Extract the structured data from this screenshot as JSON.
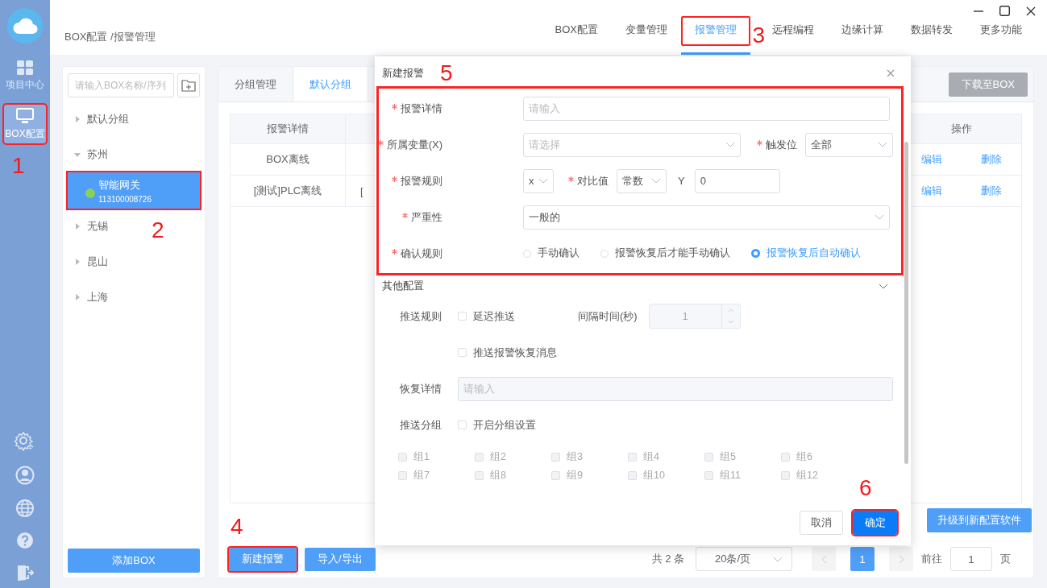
{
  "sidebar": {
    "nav": [
      {
        "label": "项目中心",
        "selected": false,
        "highlighted": false
      },
      {
        "label": "BOX配置",
        "selected": true,
        "highlighted": true,
        "annotation": "1"
      }
    ]
  },
  "breadcrumb": "BOX配置 /报警管理",
  "top_tabs": [
    {
      "label": "BOX配置",
      "selected": false,
      "highlighted": false
    },
    {
      "label": "变量管理",
      "selected": false,
      "highlighted": false
    },
    {
      "label": "报警管理",
      "selected": true,
      "highlighted": true,
      "annotation": "3"
    },
    {
      "label": "远程编程",
      "selected": false,
      "highlighted": false
    },
    {
      "label": "边缘计算",
      "selected": false,
      "highlighted": false
    },
    {
      "label": "数据转发",
      "selected": false,
      "highlighted": false
    },
    {
      "label": "更多功能",
      "selected": false,
      "highlighted": false
    }
  ],
  "box_panel": {
    "search_placeholder": "请输入BOX名称/序列",
    "tree": [
      {
        "label": "默认分组",
        "expanded": false
      },
      {
        "label": "苏州",
        "expanded": true,
        "children": [
          {
            "label": "智能网关",
            "serial": "113100008726",
            "selected": true,
            "online": true,
            "highlighted": true,
            "annotation": "2"
          }
        ]
      },
      {
        "label": "无锡",
        "expanded": false
      },
      {
        "label": "昆山",
        "expanded": false
      },
      {
        "label": "上海",
        "expanded": false
      }
    ],
    "add_button": "添加BOX"
  },
  "group_tabs": [
    {
      "label": "分组管理",
      "selected": false
    },
    {
      "label": "默认分组",
      "selected": true
    }
  ],
  "download_button": "下载至BOX",
  "table": {
    "columns": [
      "报警详情",
      "操作"
    ],
    "rows": [
      {
        "alarm_detail": "BOX离线",
        "actions": [
          "编辑",
          "删除"
        ]
      },
      {
        "alarm_detail": "[测试]PLC离线",
        "column_2": "[",
        "actions": [
          "编辑",
          "删除"
        ]
      }
    ]
  },
  "upgrade_button": "升级到新配置软件",
  "footer": {
    "buttons": [
      {
        "label": "新建报警",
        "highlighted": true,
        "annotation": "4"
      },
      {
        "label": "导入/导出",
        "highlighted": false
      }
    ],
    "pagination": {
      "total": "共 2 条",
      "page_size": "20条/页",
      "pages": [
        {
          "label": "1",
          "selected": true
        }
      ],
      "goto_label": "前往",
      "goto_value": "1",
      "goto_suffix": "页"
    }
  },
  "dialog": {
    "title": "新建报警",
    "annotation": "5",
    "rows": [
      {
        "kind": "text",
        "label": "报警详情",
        "required": true,
        "placeholder": "请输入"
      },
      {
        "kind": "variable",
        "label": "所属变量(X)",
        "required": true,
        "placeholder": "请选择",
        "trigger_label": "触发位",
        "trigger_required": true,
        "trigger_value": "全部"
      },
      {
        "kind": "rule",
        "label": "报警规则",
        "required": true,
        "operator": "x",
        "compare_label": "对比值",
        "compare_required": true,
        "compare_type": "常数",
        "y_label": "Y",
        "y_value": "0"
      },
      {
        "kind": "select",
        "label": "严重性",
        "required": true,
        "value": "一般的"
      },
      {
        "kind": "radio",
        "label": "确认规则",
        "required": true,
        "options": [
          {
            "label": "手动确认",
            "selected": false
          },
          {
            "label": "报警恢复后才能手动确认",
            "selected": false
          },
          {
            "label": "报警恢复后自动确认",
            "selected": true
          }
        ]
      }
    ],
    "other_config": {
      "title": "其他配置",
      "expanded": true,
      "push_rule_label": "推送规则",
      "delay": {
        "label": "延迟推送",
        "checked": false
      },
      "interval_label": "间隔时间(秒)",
      "interval_value": "1",
      "interval_disabled": true,
      "recovery_message": {
        "label": "推送报警恢复消息",
        "checked": false
      },
      "recovery_label": "恢复详情",
      "recovery_placeholder": "请输入",
      "recovery_disabled": true,
      "push_group_label": "推送分组",
      "group_setting": {
        "label": "开启分组设置",
        "checked": false
      },
      "groups": [
        {
          "label": "组1",
          "checked": false,
          "disabled": true
        },
        {
          "label": "组2",
          "checked": false,
          "disabled": true
        },
        {
          "label": "组3",
          "checked": false,
          "disabled": true
        },
        {
          "label": "组4",
          "checked": false,
          "disabled": true
        },
        {
          "label": "组5",
          "checked": false,
          "disabled": true
        },
        {
          "label": "组6",
          "checked": false,
          "disabled": true
        },
        {
          "label": "组7",
          "checked": false,
          "disabled": true
        },
        {
          "label": "组8",
          "checked": false,
          "disabled": true
        },
        {
          "label": "组9",
          "checked": false,
          "disabled": true
        },
        {
          "label": "组10",
          "checked": false,
          "disabled": true
        },
        {
          "label": "组11",
          "checked": false,
          "disabled": true
        },
        {
          "label": "组12",
          "checked": false,
          "disabled": true
        }
      ]
    },
    "cancel_button": "取消",
    "confirm_button": "确定",
    "confirm_annotation": "6",
    "confirm_highlighted": true
  }
}
